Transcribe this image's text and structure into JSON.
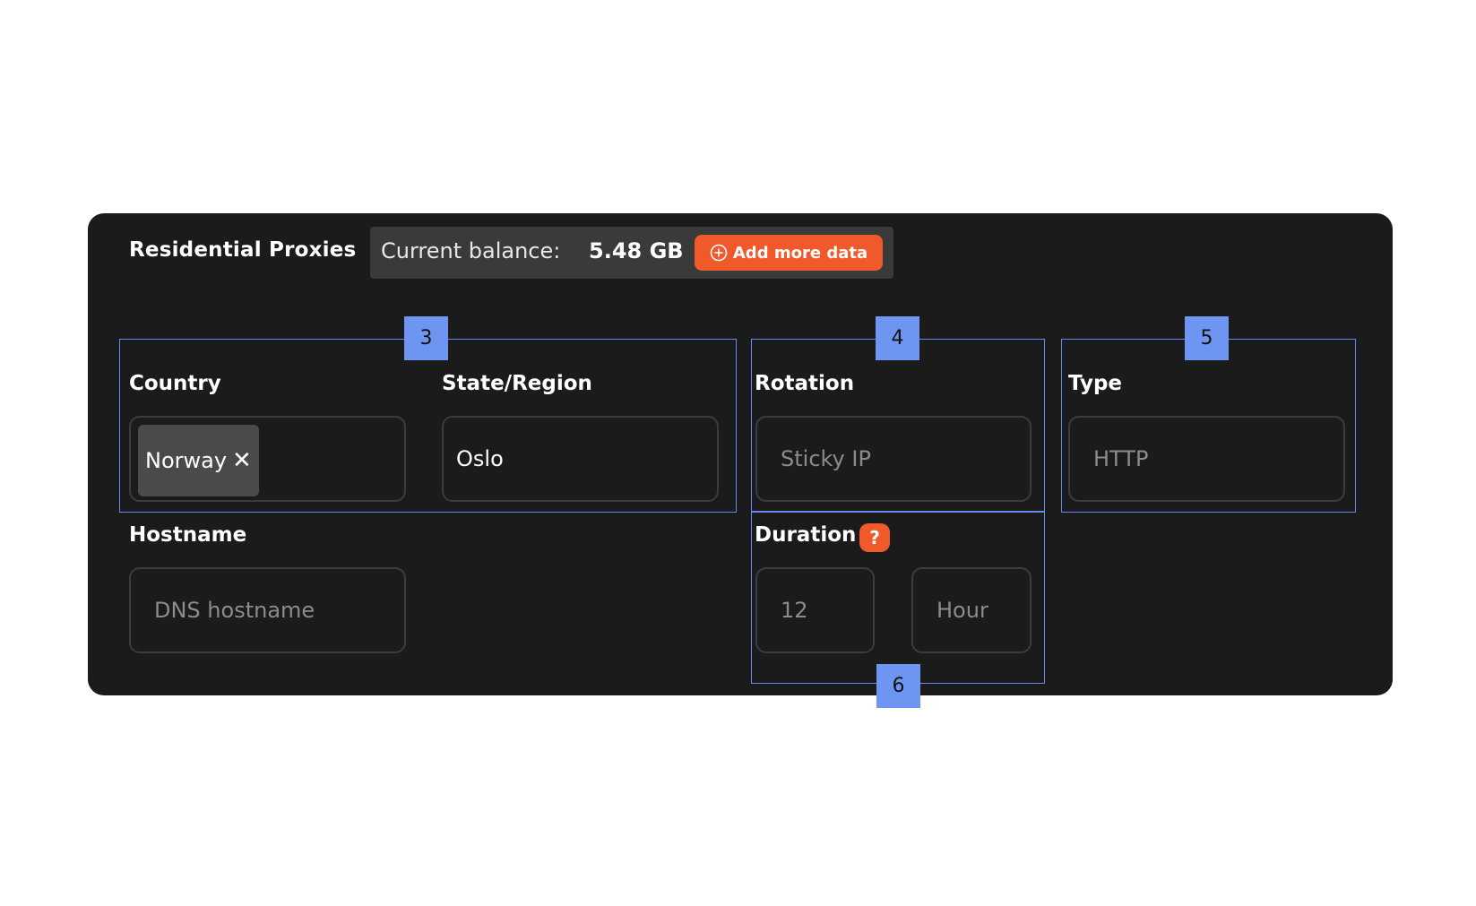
{
  "header": {
    "title": "Residential Proxies",
    "balance_label": "Current balance:",
    "balance_value": "5.48 GB",
    "add_button_label": "Add more data"
  },
  "fields": {
    "country": {
      "label": "Country",
      "chip": "Norway"
    },
    "state": {
      "label": "State/Region",
      "value": "Oslo"
    },
    "rotation": {
      "label": "Rotation",
      "placeholder": "Sticky IP"
    },
    "type": {
      "label": "Type",
      "placeholder": "HTTP"
    },
    "hostname": {
      "label": "Hostname",
      "placeholder": "DNS hostname"
    },
    "duration": {
      "label": "Duration",
      "help": "?",
      "amount_placeholder": "12",
      "unit_placeholder": "Hour"
    }
  },
  "annotations": {
    "a3": "3",
    "a4": "4",
    "a5": "5",
    "a6": "6"
  },
  "colors": {
    "panel": "#1b1b1c",
    "accent": "#f0592a",
    "annotation": "#6e95f2"
  },
  "icons": {
    "add": "plus-circle-icon",
    "remove_chip": "close-icon",
    "help": "question-icon"
  }
}
